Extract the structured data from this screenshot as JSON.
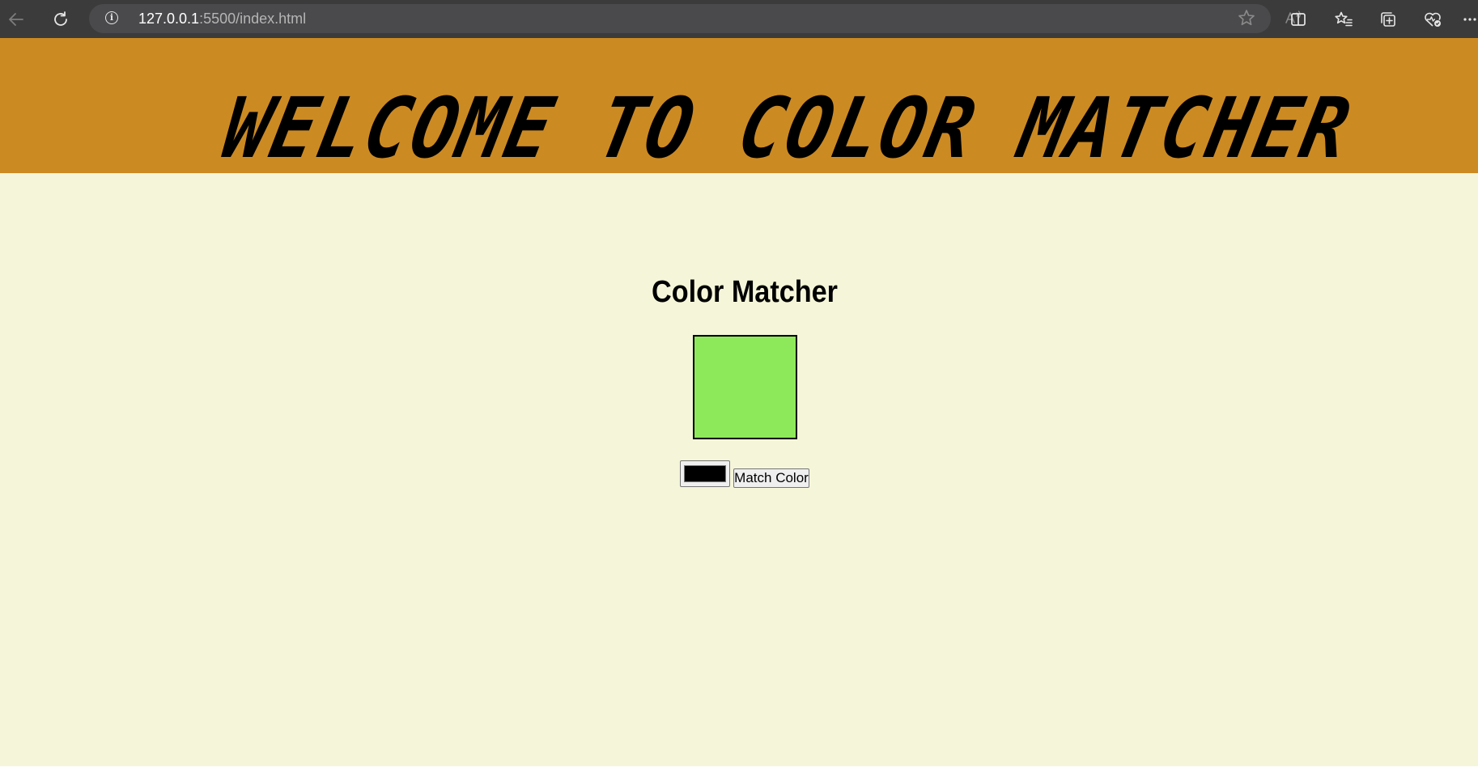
{
  "browser": {
    "url_host": "127.0.0.1",
    "url_path": ":5500/index.html",
    "icons": [
      "back-arrow-icon",
      "refresh-icon",
      "site-info-icon",
      "read-aloud-icon",
      "favorite-star-icon",
      "split-screen-icon",
      "favorites-icon",
      "collections-icon",
      "browser-essentials-icon",
      "more-options-icon"
    ]
  },
  "page": {
    "background": "#f5f5d9"
  },
  "banner": {
    "title": "WELCOME TO COLOR MATCHER",
    "background": "#cc8a22"
  },
  "app": {
    "heading": "Color Matcher",
    "target_color": "#8ee95a",
    "picker_value": "#000000",
    "match_button_label": "Match Color"
  }
}
